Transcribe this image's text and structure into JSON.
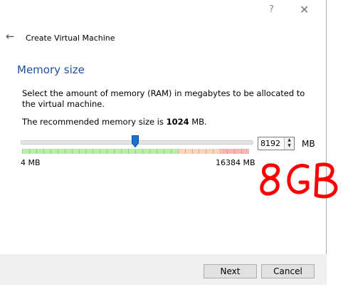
{
  "window": {
    "help_glyph": "?",
    "close_glyph": "✕"
  },
  "wizard": {
    "title": "Create Virtual Machine",
    "back_glyph": "←"
  },
  "page": {
    "title": "Memory size",
    "description": "Select the amount of memory (RAM) in megabytes to be allocated to the virtual machine.",
    "recommend_prefix": "The recommended memory size is ",
    "recommend_value": "1024",
    "recommend_suffix": " MB."
  },
  "memory": {
    "min_label": "4 MB",
    "max_label": "16384 MB",
    "value": "8192",
    "unit": "MB",
    "min": 4,
    "max": 16384,
    "current": 8192,
    "green_fraction": 0.69,
    "orange_fraction": 0.19,
    "red_fraction": 0.12
  },
  "annotation": {
    "text": "8GB",
    "color": "#ff0000"
  },
  "buttons": {
    "next": "Next",
    "cancel": "Cancel"
  }
}
